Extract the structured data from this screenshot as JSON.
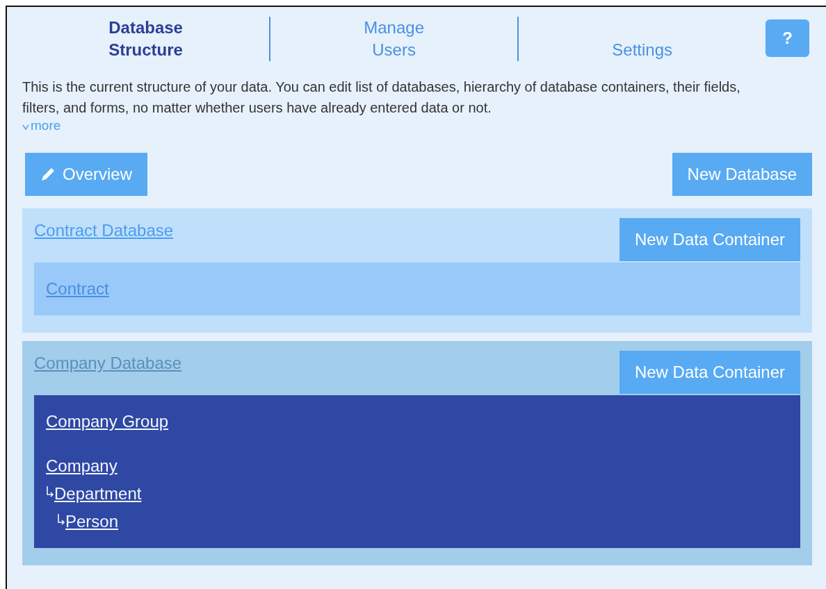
{
  "tabs": [
    {
      "label": "Database Structure",
      "selected": true
    },
    {
      "label": "Manage Users",
      "selected": false
    },
    {
      "label": "Settings",
      "selected": false
    }
  ],
  "help_button": "?",
  "description": "This is the current structure of your data. You can edit list of databases, hierarchy of database containers, their fields, filters, and forms, no matter whether users have already entered data or not.",
  "more_link": "more",
  "overview_button": "Overview",
  "new_database_button": "New Database",
  "databases": [
    {
      "title": "Contract Database",
      "selected": false,
      "button": "New Data Container",
      "groups": [
        [
          {
            "label": "Contract"
          }
        ]
      ]
    },
    {
      "title": "Company Database",
      "selected": true,
      "button": "New Data Container",
      "groups": [
        [
          {
            "label": "Company Group"
          }
        ],
        [
          {
            "label": "Company",
            "children": [
              {
                "label": "Department",
                "children": [
                  {
                    "label": "Person"
                  }
                ]
              }
            ]
          }
        ]
      ]
    }
  ]
}
